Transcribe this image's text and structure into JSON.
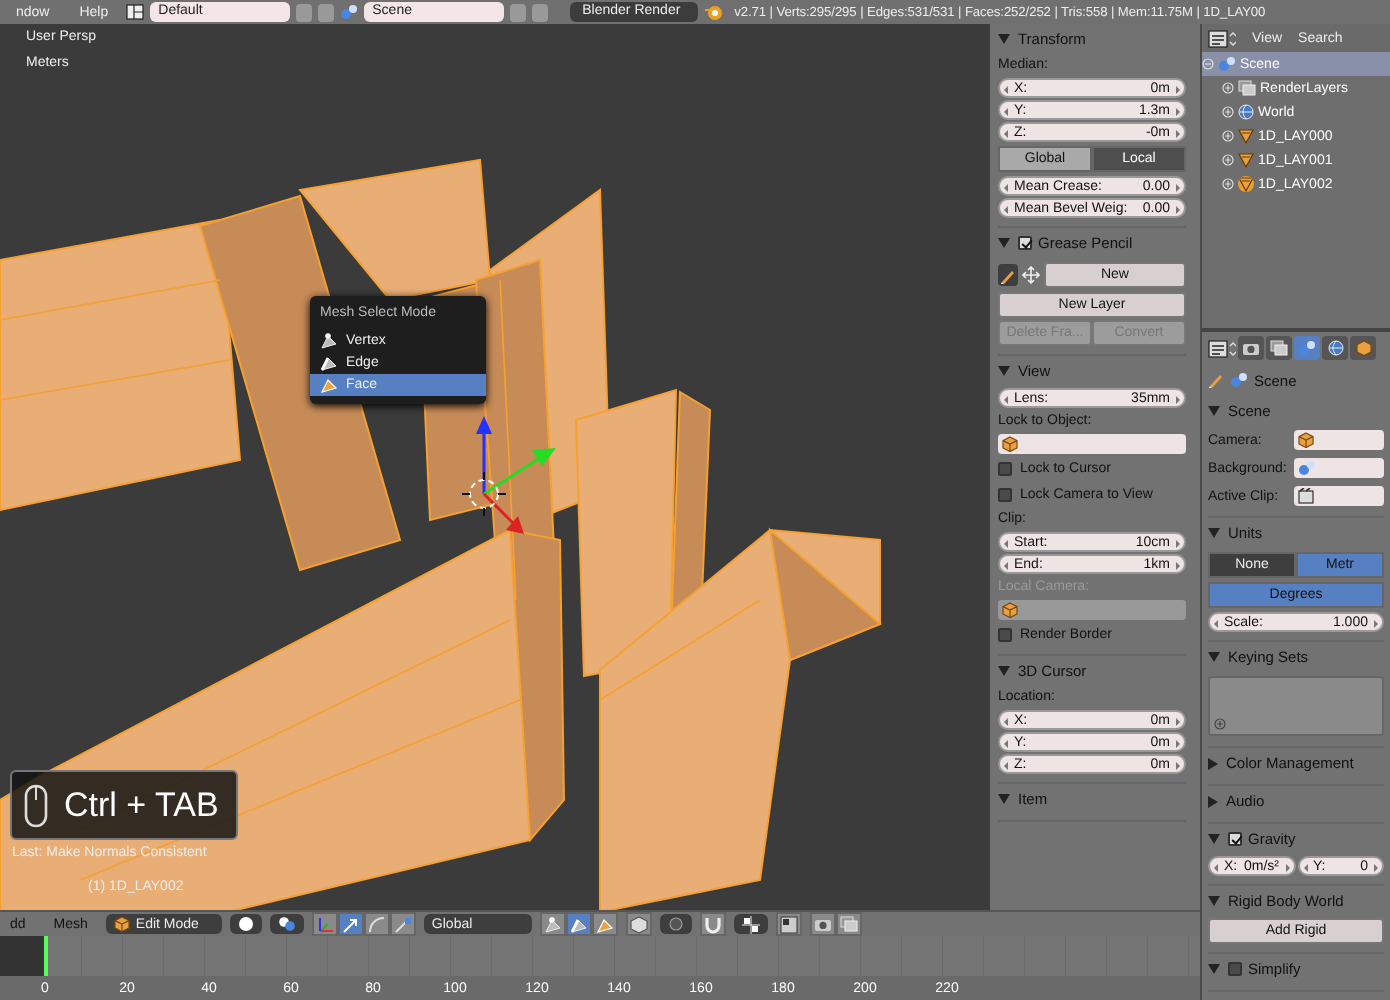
{
  "top_bar": {
    "menus": [
      "ndow",
      "Help"
    ],
    "screen_layout": "Default",
    "scene": "Scene",
    "render_engine": "Blender Render",
    "stats": "v2.71 | Verts:295/295 | Edges:531/531 | Faces:252/252 | Tris:558 | Mem:11.75M | 1D_LAY00"
  },
  "viewport": {
    "view_name": "User Persp",
    "units": "Meters",
    "select_menu": {
      "title": "Mesh Select Mode",
      "items": [
        {
          "kind": "vertex",
          "label": "Vertex",
          "selected": false
        },
        {
          "kind": "edge",
          "label": "Edge",
          "selected": false
        },
        {
          "kind": "face",
          "label": "Face",
          "selected": true
        }
      ]
    },
    "key_hint": "Ctrl + TAB",
    "last_operator": "Last: Make Normals Consistent",
    "object_info": "(1) 1D_LAY002"
  },
  "properties_shelf": {
    "panels": [
      {
        "title": "Transform",
        "expanded": true,
        "rows": [
          {
            "kind": "label",
            "text": "Median:",
            "disabled": false
          },
          {
            "kind": "field",
            "label": "X:",
            "value": "0m"
          },
          {
            "kind": "field",
            "label": "Y:",
            "value": "1.3m"
          },
          {
            "kind": "field",
            "label": "Z:",
            "value": "-0m"
          },
          {
            "kind": "toggle",
            "options": [
              {
                "label": "Global",
                "selected": false
              },
              {
                "label": "Local",
                "selected": true
              }
            ]
          },
          {
            "kind": "field",
            "label": "Mean Crease:",
            "value": "0.00"
          },
          {
            "kind": "field",
            "label": "Mean Bevel Weig:",
            "value": "0.00"
          }
        ]
      },
      {
        "title": "Grease Pencil",
        "checked": true,
        "expanded": true,
        "rows": [
          {
            "kind": "new_row",
            "label": "New"
          },
          {
            "kind": "buttons",
            "buttons": [
              {
                "label": "New Layer",
                "disabled": false
              }
            ]
          },
          {
            "kind": "buttons",
            "buttons": [
              {
                "label": "Delete Fra...",
                "disabled": true
              },
              {
                "label": "Convert",
                "disabled": true
              }
            ]
          }
        ]
      },
      {
        "title": "View",
        "expanded": true,
        "rows": [
          {
            "kind": "field",
            "label": "Lens:",
            "value": "35mm"
          },
          {
            "kind": "label",
            "text": "Lock to Object:",
            "disabled": false
          },
          {
            "kind": "object_field",
            "disabled": false
          },
          {
            "kind": "checkbox",
            "label": "Lock to Cursor",
            "checked": false
          },
          {
            "kind": "checkbox",
            "label": "Lock Camera to View",
            "checked": false
          },
          {
            "kind": "label",
            "text": "Clip:",
            "disabled": false
          },
          {
            "kind": "field",
            "label": "Start:",
            "value": "10cm"
          },
          {
            "kind": "field",
            "label": "End:",
            "value": "1km"
          },
          {
            "kind": "label",
            "text": "Local Camera:",
            "disabled": true
          },
          {
            "kind": "object_field",
            "disabled": true
          },
          {
            "kind": "checkbox",
            "label": "Render Border",
            "checked": false
          }
        ]
      },
      {
        "title": "3D Cursor",
        "expanded": true,
        "rows": [
          {
            "kind": "label",
            "text": "Location:",
            "disabled": false
          },
          {
            "kind": "field",
            "label": "X:",
            "value": "0m"
          },
          {
            "kind": "field",
            "label": "Y:",
            "value": "0m"
          },
          {
            "kind": "field",
            "label": "Z:",
            "value": "0m"
          }
        ]
      },
      {
        "title": "Item",
        "expanded": true
      }
    ]
  },
  "outliner": {
    "menus": [
      "View",
      "Search"
    ],
    "tree": [
      {
        "kind": "scene",
        "label": "Scene",
        "selected": true,
        "active": false,
        "expanded": true,
        "children": [
          {
            "kind": "render_layers",
            "label": "RenderLayers",
            "selected": false,
            "active": false,
            "expanded": false
          },
          {
            "kind": "world",
            "label": "World",
            "selected": false,
            "active": false,
            "expanded": false
          },
          {
            "kind": "mesh_object",
            "label": "1D_LAY000",
            "selected": false,
            "active": false,
            "expanded": false
          },
          {
            "kind": "mesh_object",
            "label": "1D_LAY001",
            "selected": false,
            "active": false,
            "expanded": false
          },
          {
            "kind": "mesh_object",
            "label": "1D_LAY002",
            "selected": false,
            "active": true,
            "expanded": false
          }
        ]
      }
    ]
  },
  "properties_editor": {
    "tabs": [
      {
        "kind": "render",
        "selected": false
      },
      {
        "kind": "render_layers",
        "selected": false
      },
      {
        "kind": "scene",
        "selected": true
      },
      {
        "kind": "world",
        "selected": false
      },
      {
        "kind": "object",
        "selected": false
      }
    ],
    "breadcrumb": "Scene",
    "panels": [
      {
        "title": "Scene",
        "expanded": true,
        "rows": [
          {
            "kind": "prop_field",
            "label": "Camera:",
            "field": {
              "kind": "object"
            }
          },
          {
            "kind": "prop_field",
            "label": "Background:",
            "field": {
              "kind": "scene"
            }
          },
          {
            "kind": "prop_field",
            "label": "Active Clip:",
            "field": {
              "kind": "movie_clip"
            }
          }
        ]
      },
      {
        "title": "Units",
        "expanded": true,
        "rows": [
          {
            "kind": "enum",
            "options": [
              {
                "label": "None",
                "selected": false
              },
              {
                "label": "Metr",
                "selected": true
              }
            ]
          },
          {
            "kind": "enum",
            "options": [
              {
                "label": "Degrees",
                "selected": true
              }
            ]
          },
          {
            "kind": "field",
            "label": "Scale:",
            "value": "1.000"
          }
        ]
      },
      {
        "title": "Keying Sets",
        "expanded": true,
        "rows": [
          {
            "kind": "list_box"
          }
        ]
      },
      {
        "title": "Color Management",
        "expanded": false
      },
      {
        "title": "Audio",
        "expanded": false
      },
      {
        "title": "Gravity",
        "checked": true,
        "expanded": true,
        "rows": [
          {
            "kind": "field_pair",
            "fields": [
              {
                "label": "X:",
                "value": "0m/s²"
              },
              {
                "label": "Y:",
                "value": "0"
              }
            ]
          }
        ]
      },
      {
        "title": "Rigid Body World",
        "expanded": true,
        "rows": [
          {
            "kind": "buttons",
            "buttons": [
              {
                "label": "Add Rigid",
                "disabled": false
              }
            ]
          }
        ]
      },
      {
        "title": "Simplify",
        "checked": false,
        "expanded": true
      }
    ]
  },
  "view3d_header": {
    "items": [
      {
        "kind": "menu",
        "label": "dd"
      },
      {
        "kind": "menu",
        "label": "Mesh"
      },
      {
        "kind": "mode_dropdown",
        "label": "Edit Mode"
      },
      {
        "kind": "icon_dropdown",
        "button": {
          "kind": "sphere"
        }
      },
      {
        "kind": "icon_dropdown",
        "button": {
          "kind": "pivot"
        }
      },
      {
        "kind": "icon_group",
        "buttons": [
          {
            "kind": "axes",
            "selected": false
          },
          {
            "kind": "translate",
            "selected": true
          },
          {
            "kind": "rotate",
            "selected": false
          },
          {
            "kind": "scale",
            "selected": false
          }
        ]
      },
      {
        "kind": "dropdown",
        "label": "Global"
      },
      {
        "kind": "icon_group",
        "buttons": [
          {
            "kind": "vertex",
            "selected": false
          },
          {
            "kind": "edge",
            "selected": true
          },
          {
            "kind": "face",
            "selected": false
          }
        ]
      },
      {
        "kind": "icon_group",
        "buttons": [
          {
            "kind": "occlude",
            "selected": false
          }
        ]
      },
      {
        "kind": "icon_dropdown",
        "button": {
          "kind": "proportional"
        }
      },
      {
        "kind": "icon_group",
        "buttons": [
          {
            "kind": "snap",
            "selected": false
          }
        ]
      },
      {
        "kind": "icon_dropdown",
        "button": {
          "kind": "snap_target"
        }
      },
      {
        "kind": "icon_group",
        "buttons": [
          {
            "kind": "layers",
            "selected": false
          }
        ]
      },
      {
        "kind": "icon_group",
        "buttons": [
          {
            "kind": "render",
            "selected": false
          },
          {
            "kind": "render_layers",
            "selected": false
          }
        ]
      }
    ]
  },
  "timeline": {
    "playhead": {
      "level": 0
    },
    "ticks": [
      "0",
      "20",
      "40",
      "60",
      "80",
      "100",
      "120",
      "140",
      "160",
      "180",
      "200",
      "220"
    ]
  }
}
